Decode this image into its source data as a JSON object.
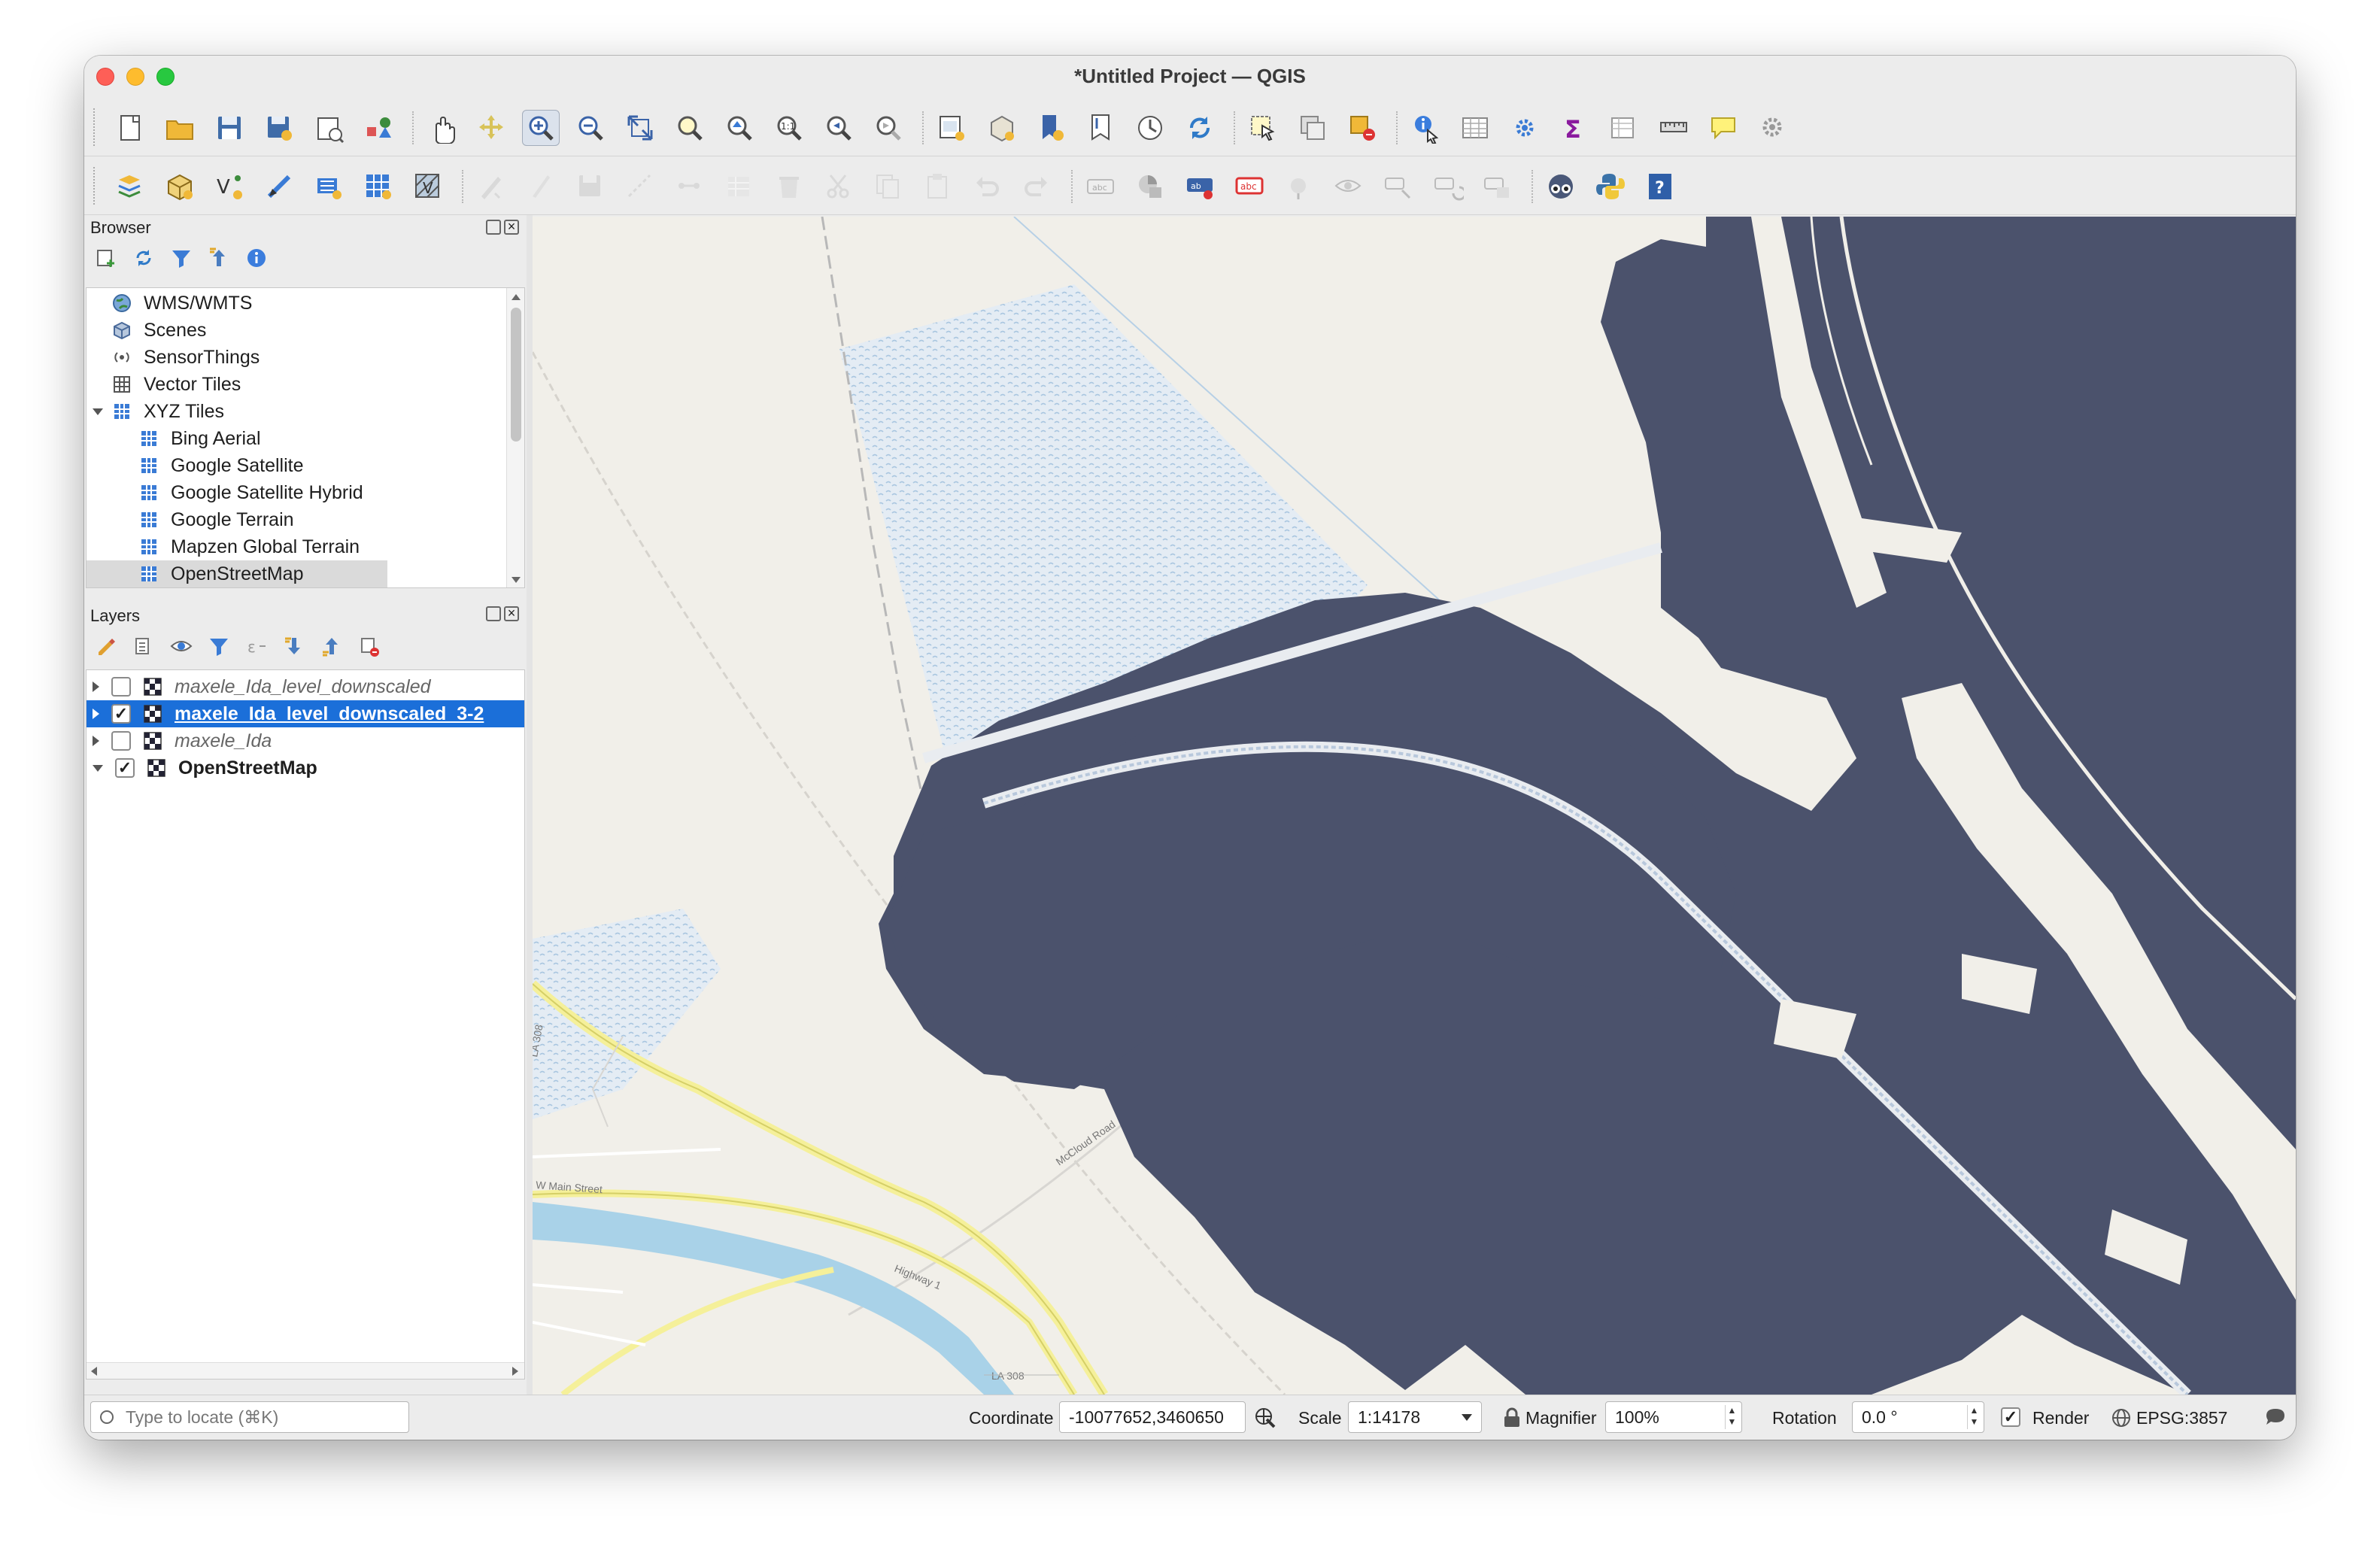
{
  "window": {
    "title": "*Untitled Project — QGIS"
  },
  "toolbar1": [
    {
      "icon": "new-project-icon"
    },
    {
      "icon": "open-project-icon"
    },
    {
      "icon": "save-project-icon"
    },
    {
      "icon": "save-as-icon"
    },
    {
      "icon": "print-layout-icon"
    },
    {
      "icon": "style-manager-icon"
    },
    {
      "icon": "pan-map-icon"
    },
    {
      "icon": "pan-to-selection-icon"
    },
    {
      "icon": "zoom-in-icon",
      "active": true
    },
    {
      "icon": "zoom-out-icon"
    },
    {
      "icon": "zoom-full-icon"
    },
    {
      "icon": "zoom-to-selection-icon"
    },
    {
      "icon": "zoom-to-layer-icon"
    },
    {
      "icon": "zoom-native-icon"
    },
    {
      "icon": "zoom-last-icon"
    },
    {
      "icon": "zoom-next-icon"
    },
    {
      "icon": "new-map-view-icon"
    },
    {
      "icon": "new-3d-view-icon"
    },
    {
      "icon": "new-bookmark-icon"
    },
    {
      "icon": "show-bookmarks-icon"
    },
    {
      "icon": "temporal-controller-icon"
    },
    {
      "icon": "refresh-icon"
    },
    {
      "icon": "select-features-icon"
    },
    {
      "icon": "deselect-icon"
    },
    {
      "icon": "select-by-value-icon"
    },
    {
      "icon": "identify-features-icon"
    },
    {
      "icon": "attribute-table-icon"
    },
    {
      "icon": "processing-toolbox-icon"
    },
    {
      "icon": "statistical-summary-icon"
    },
    {
      "icon": "open-field-calculator-icon"
    },
    {
      "icon": "measure-line-icon"
    },
    {
      "icon": "map-tips-icon"
    },
    {
      "icon": "locator-settings-icon"
    }
  ],
  "toolbar2": [
    {
      "icon": "data-source-manager-icon"
    },
    {
      "icon": "new-geopackage-layer-icon"
    },
    {
      "icon": "new-shapefile-layer-icon"
    },
    {
      "icon": "new-temporary-layer-icon"
    },
    {
      "icon": "new-virtual-layer-icon"
    },
    {
      "icon": "add-raster-layer-icon"
    },
    {
      "icon": "add-mesh-layer-icon"
    },
    {
      "icon": "current-edits-icon"
    },
    {
      "icon": "toggle-editing-icon"
    },
    {
      "icon": "save-edits-icon"
    },
    {
      "icon": "digitize-icon"
    },
    {
      "icon": "vertex-tool-icon"
    },
    {
      "icon": "modify-attributes-icon"
    },
    {
      "icon": "delete-selected-icon"
    },
    {
      "icon": "cut-features-icon"
    },
    {
      "icon": "copy-features-icon"
    },
    {
      "icon": "paste-features-icon"
    },
    {
      "icon": "undo-icon"
    },
    {
      "icon": "redo-icon"
    },
    {
      "icon": "label-toolbar-icon"
    },
    {
      "icon": "diagram-icon"
    },
    {
      "icon": "layer-labeling-options-icon"
    },
    {
      "icon": "layer-diagram-options-icon"
    },
    {
      "icon": "pin-labels-icon"
    },
    {
      "icon": "show-hide-labels-icon"
    },
    {
      "icon": "move-label-icon"
    },
    {
      "icon": "rotate-label-icon"
    },
    {
      "icon": "change-label-icon"
    },
    {
      "icon": "plugin-icon"
    },
    {
      "icon": "python-console-icon"
    },
    {
      "icon": "help-icon"
    }
  ],
  "browser": {
    "title": "Browser",
    "items": [
      {
        "label": "WMS/WMTS",
        "icon": "globe-icon",
        "indent": 0
      },
      {
        "label": "Scenes",
        "icon": "cube-icon",
        "indent": 0
      },
      {
        "label": "SensorThings",
        "icon": "sensor-icon",
        "indent": 0
      },
      {
        "label": "Vector Tiles",
        "icon": "grid-icon",
        "indent": 0
      },
      {
        "label": "XYZ Tiles",
        "icon": "tiles-icon",
        "indent": 0,
        "expanded": true
      },
      {
        "label": "Bing Aerial",
        "icon": "tiles-icon",
        "indent": 1
      },
      {
        "label": "Google Satellite",
        "icon": "tiles-icon",
        "indent": 1
      },
      {
        "label": "Google Satellite Hybrid",
        "icon": "tiles-icon",
        "indent": 1
      },
      {
        "label": "Google Terrain",
        "icon": "tiles-icon",
        "indent": 1
      },
      {
        "label": "Mapzen Global Terrain",
        "icon": "tiles-icon",
        "indent": 1
      },
      {
        "label": "OpenStreetMap",
        "icon": "tiles-icon",
        "indent": 1,
        "selected": true
      }
    ]
  },
  "layers": {
    "title": "Layers",
    "items": [
      {
        "label": "maxele_Ida_level_downscaled",
        "checked": false,
        "italic": true,
        "selected": false,
        "expanded": false
      },
      {
        "label": "maxele_Ida_level_downscaled_3-2",
        "checked": true,
        "italic": false,
        "selected": true,
        "expanded": false
      },
      {
        "label": "maxele_Ida",
        "checked": false,
        "italic": true,
        "selected": false,
        "expanded": false
      },
      {
        "label": "OpenStreetMap",
        "checked": true,
        "italic": false,
        "bold": true,
        "selected": false,
        "expanded": true
      }
    ]
  },
  "map": {
    "flood_color": "#4b526c",
    "labels": [
      "LA 308",
      "W Main Street",
      "Highway 1",
      "McCloud Road"
    ]
  },
  "status": {
    "locator_placeholder": "Type to locate (⌘K)",
    "coordinate_label": "Coordinate",
    "coordinate_value": "-10077652,3460650",
    "scale_label": "Scale",
    "scale_value": "1:14178",
    "magnifier_label": "Magnifier",
    "magnifier_value": "100%",
    "rotation_label": "Rotation",
    "rotation_value": "0.0 °",
    "render_label": "Render",
    "render_checked": true,
    "crs": "EPSG:3857"
  }
}
